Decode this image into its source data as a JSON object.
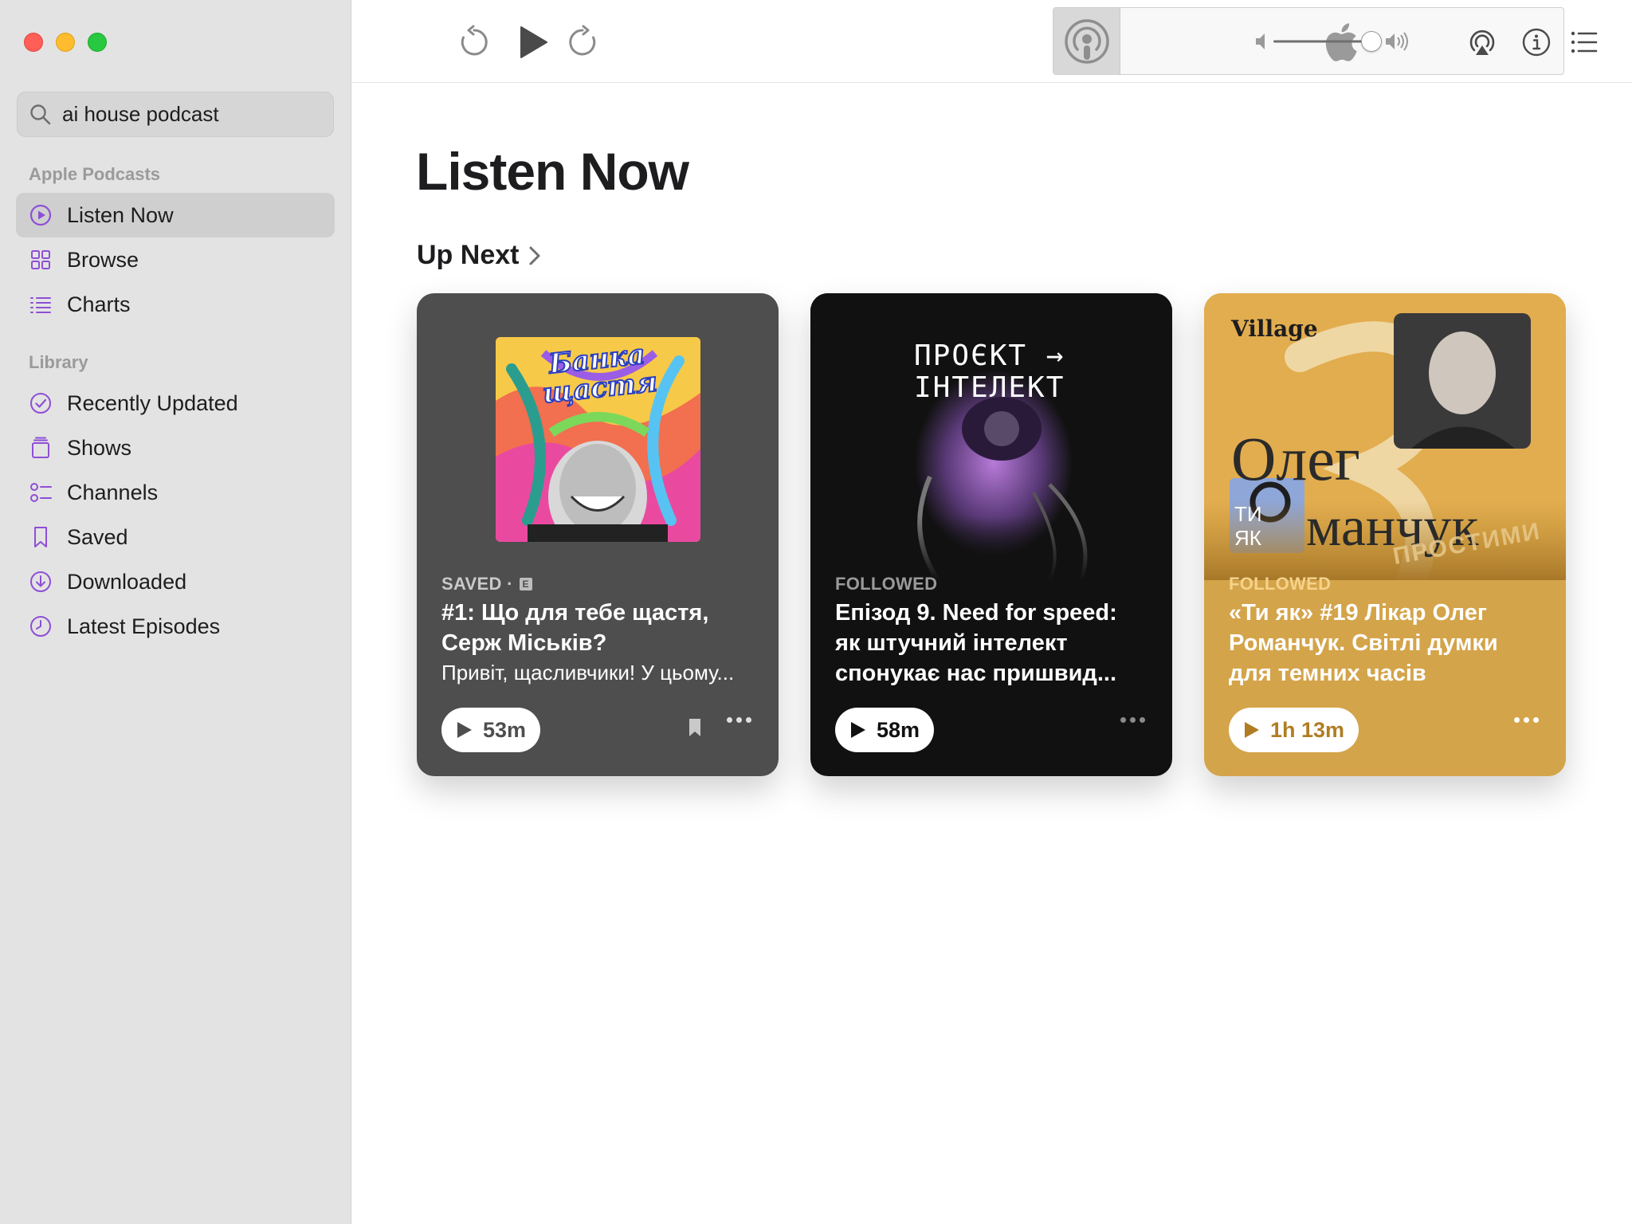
{
  "window": {
    "title": "Apple Podcasts"
  },
  "search": {
    "value": "ai house podcast"
  },
  "sidebar": {
    "section_apple": "Apple Podcasts",
    "section_library": "Library",
    "apple_items": [
      {
        "label": "Listen Now",
        "icon": "play-circle-icon",
        "active": true
      },
      {
        "label": "Browse",
        "icon": "grid-icon"
      },
      {
        "label": "Charts",
        "icon": "list-numbered-icon"
      }
    ],
    "library_items": [
      {
        "label": "Recently Updated",
        "icon": "checkmark-circle-icon"
      },
      {
        "label": "Shows",
        "icon": "stack-icon"
      },
      {
        "label": "Channels",
        "icon": "channels-icon"
      },
      {
        "label": "Saved",
        "icon": "bookmark-icon"
      },
      {
        "label": "Downloaded",
        "icon": "download-circle-icon"
      },
      {
        "label": "Latest Episodes",
        "icon": "clock-icon"
      }
    ]
  },
  "toolbar": {
    "skip_back_icon": "skip-back-icon",
    "play_icon": "play-icon",
    "skip_forward_icon": "skip-forward-icon",
    "volume_level": 0.85,
    "airplay_icon": "airplay-icon",
    "info_icon": "info-icon",
    "queue_icon": "queue-list-icon"
  },
  "main": {
    "title": "Listen Now",
    "up_next": "Up Next"
  },
  "cards": [
    {
      "tag": "SAVED ·",
      "explicit_badge": "E",
      "title_line1": "#1: Що для тебе щастя,",
      "title_line2": "Серж Міськів?",
      "description": "Привіт, щасливчики! У цьому...",
      "duration": "53m",
      "art_text": "Банка щастя",
      "bg": "#4e4e4e",
      "tag_color": "#c9c9c9"
    },
    {
      "tag": "FOLLOWED",
      "title_line1": "Епізод 9. Need for speed:",
      "title_line2": "як штучний інтелект",
      "title_line3": "спонукає нас пришвид...",
      "duration": "58m",
      "art_text_1": "ПРОЄКТ →",
      "art_text_2": "ІНТЕЛЕКТ",
      "bg": "#111111",
      "tag_color": "#9a9a9a"
    },
    {
      "tag": "FOLLOWED",
      "title_line1": "«Ти як» #19 Лікар Олег",
      "title_line2": "Романчук. Світлі думки",
      "title_line3": "для темних часів",
      "duration": "1h 13m",
      "art_brand": "Village",
      "art_name_1": "Олег",
      "art_name_2": "манчук",
      "art_stamp": "ПРОСТИМИ",
      "art_badge_1": "ТИ",
      "art_badge_2": "ЯК",
      "bg": "#d4a44a",
      "tag_color": "#f6d28a"
    }
  ]
}
